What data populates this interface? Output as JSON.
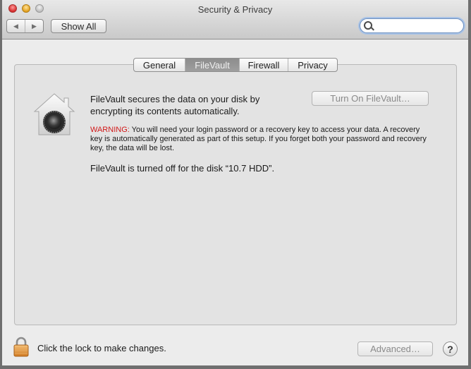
{
  "window": {
    "title": "Security & Privacy"
  },
  "toolbar": {
    "back_icon": "triangle-left",
    "forward_icon": "triangle-right",
    "show_all_label": "Show All",
    "search": {
      "value": "",
      "placeholder": "",
      "icon": "search-icon"
    }
  },
  "tabs": [
    {
      "label": "General",
      "active": false
    },
    {
      "label": "FileVault",
      "active": true
    },
    {
      "label": "Firewall",
      "active": false
    },
    {
      "label": "Privacy",
      "active": false
    }
  ],
  "filevault": {
    "icon": "filevault-house-safe",
    "description": "FileVault secures the data on your disk by encrypting its contents automatically.",
    "turn_on_label": "Turn On FileVault…",
    "warning_label": "WARNING:",
    "warning_text": " You will need your login password or a recovery key to access your data. A recovery key is automatically generated as part of this setup. If you forget both your password and recovery key, the data will be lost.",
    "status": "FileVault is turned off for the disk “10.7 HDD”."
  },
  "footer": {
    "lock_icon": "padlock-locked",
    "lock_text": "Click the lock to make changes.",
    "advanced_label": "Advanced…",
    "help_label": "?"
  },
  "colors": {
    "warning": "#d21717",
    "active_tab": "#929292",
    "search_focus": "#a9c3e6"
  }
}
